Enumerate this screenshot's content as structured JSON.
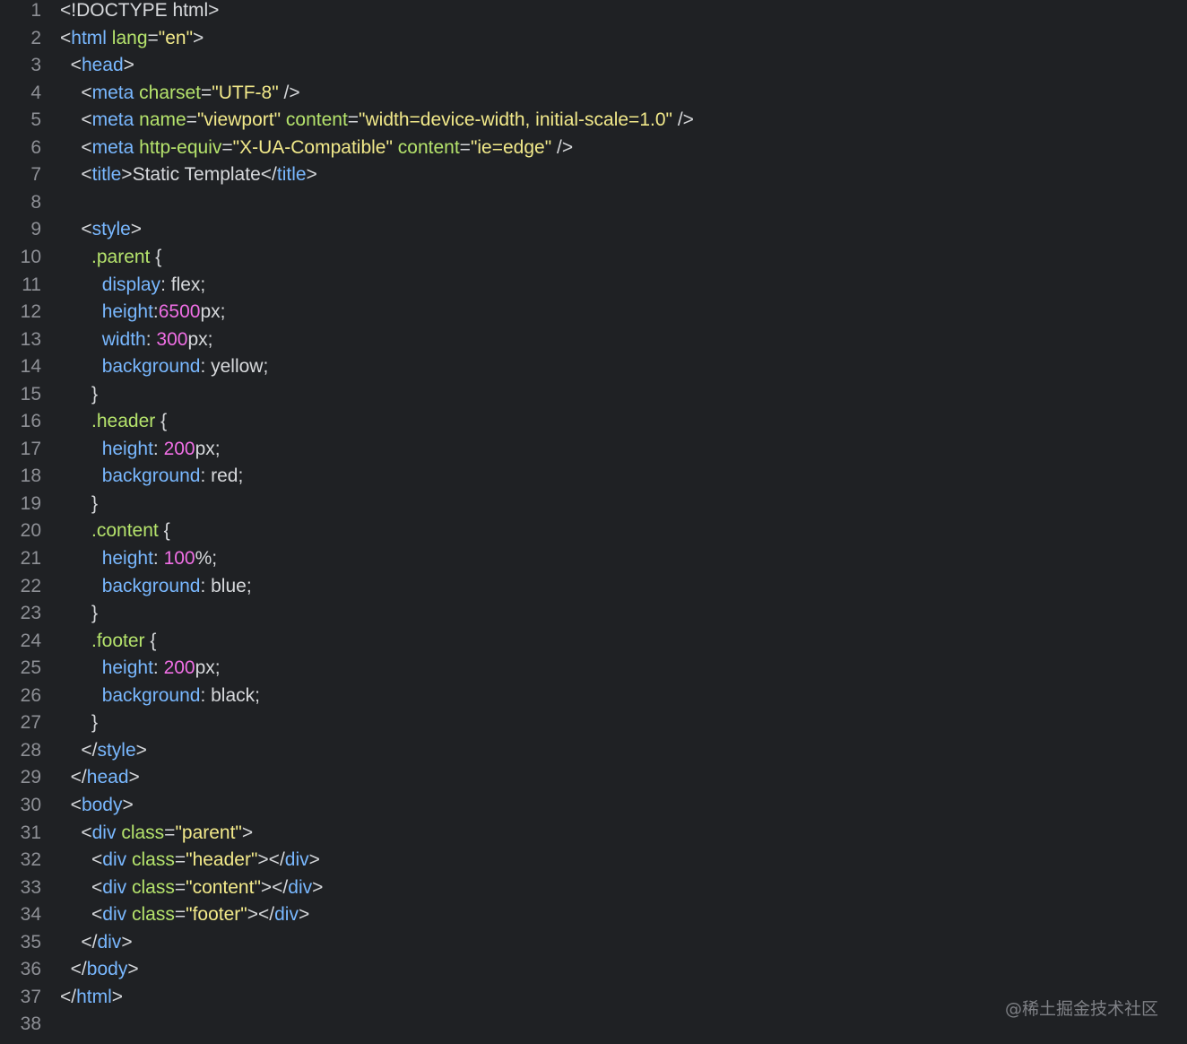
{
  "editor": {
    "lines": [
      {
        "n": "1",
        "tokens": [
          [
            "doctype",
            "<!DOCTYPE html>"
          ]
        ]
      },
      {
        "n": "2",
        "tokens": [
          [
            "punc",
            "<"
          ],
          [
            "tag",
            "html"
          ],
          [
            "text",
            " "
          ],
          [
            "attr",
            "lang"
          ],
          [
            "punc",
            "="
          ],
          [
            "str",
            "\"en\""
          ],
          [
            "punc",
            ">"
          ]
        ]
      },
      {
        "n": "3",
        "tokens": [
          [
            "text",
            "  "
          ],
          [
            "punc",
            "<"
          ],
          [
            "tag",
            "head"
          ],
          [
            "punc",
            ">"
          ]
        ]
      },
      {
        "n": "4",
        "tokens": [
          [
            "text",
            "    "
          ],
          [
            "punc",
            "<"
          ],
          [
            "tag",
            "meta"
          ],
          [
            "text",
            " "
          ],
          [
            "attr",
            "charset"
          ],
          [
            "punc",
            "="
          ],
          [
            "str",
            "\"UTF-8\""
          ],
          [
            "text",
            " "
          ],
          [
            "punc",
            "/>"
          ]
        ]
      },
      {
        "n": "5",
        "tokens": [
          [
            "text",
            "    "
          ],
          [
            "punc",
            "<"
          ],
          [
            "tag",
            "meta"
          ],
          [
            "text",
            " "
          ],
          [
            "attr",
            "name"
          ],
          [
            "punc",
            "="
          ],
          [
            "str",
            "\"viewport\""
          ],
          [
            "text",
            " "
          ],
          [
            "attr",
            "content"
          ],
          [
            "punc",
            "="
          ],
          [
            "str",
            "\"width=device-width, initial-scale=1.0\""
          ],
          [
            "text",
            " "
          ],
          [
            "punc",
            "/>"
          ]
        ]
      },
      {
        "n": "6",
        "tokens": [
          [
            "text",
            "    "
          ],
          [
            "punc",
            "<"
          ],
          [
            "tag",
            "meta"
          ],
          [
            "text",
            " "
          ],
          [
            "attr",
            "http-equiv"
          ],
          [
            "punc",
            "="
          ],
          [
            "str",
            "\"X-UA-Compatible\""
          ],
          [
            "text",
            " "
          ],
          [
            "attr",
            "content"
          ],
          [
            "punc",
            "="
          ],
          [
            "str",
            "\"ie=edge\""
          ],
          [
            "text",
            " "
          ],
          [
            "punc",
            "/>"
          ]
        ]
      },
      {
        "n": "7",
        "tokens": [
          [
            "text",
            "    "
          ],
          [
            "punc",
            "<"
          ],
          [
            "tag",
            "title"
          ],
          [
            "punc",
            ">"
          ],
          [
            "text",
            "Static Template"
          ],
          [
            "punc",
            "</"
          ],
          [
            "tag",
            "title"
          ],
          [
            "punc",
            ">"
          ]
        ]
      },
      {
        "n": "8",
        "tokens": []
      },
      {
        "n": "9",
        "tokens": [
          [
            "text",
            "    "
          ],
          [
            "punc",
            "<"
          ],
          [
            "tag",
            "style"
          ],
          [
            "punc",
            ">"
          ]
        ]
      },
      {
        "n": "10",
        "tokens": [
          [
            "text",
            "      "
          ],
          [
            "sel",
            ".parent"
          ],
          [
            "text",
            " "
          ],
          [
            "punc",
            "{"
          ]
        ]
      },
      {
        "n": "11",
        "tokens": [
          [
            "text",
            "        "
          ],
          [
            "prop",
            "display"
          ],
          [
            "punc",
            ": "
          ],
          [
            "val",
            "flex;"
          ]
        ]
      },
      {
        "n": "12",
        "tokens": [
          [
            "text",
            "        "
          ],
          [
            "prop",
            "height"
          ],
          [
            "punc",
            ":"
          ],
          [
            "num",
            "6500"
          ],
          [
            "val",
            "px;"
          ]
        ]
      },
      {
        "n": "13",
        "tokens": [
          [
            "text",
            "        "
          ],
          [
            "prop",
            "width"
          ],
          [
            "punc",
            ": "
          ],
          [
            "num",
            "300"
          ],
          [
            "val",
            "px;"
          ]
        ]
      },
      {
        "n": "14",
        "tokens": [
          [
            "text",
            "        "
          ],
          [
            "prop",
            "background"
          ],
          [
            "punc",
            ": "
          ],
          [
            "val",
            "yellow;"
          ]
        ]
      },
      {
        "n": "15",
        "tokens": [
          [
            "text",
            "      "
          ],
          [
            "punc",
            "}"
          ]
        ]
      },
      {
        "n": "16",
        "tokens": [
          [
            "text",
            "      "
          ],
          [
            "sel",
            ".header"
          ],
          [
            "text",
            " "
          ],
          [
            "punc",
            "{"
          ]
        ]
      },
      {
        "n": "17",
        "tokens": [
          [
            "text",
            "        "
          ],
          [
            "prop",
            "height"
          ],
          [
            "punc",
            ": "
          ],
          [
            "num",
            "200"
          ],
          [
            "val",
            "px;"
          ]
        ]
      },
      {
        "n": "18",
        "tokens": [
          [
            "text",
            "        "
          ],
          [
            "prop",
            "background"
          ],
          [
            "punc",
            ": "
          ],
          [
            "val",
            "red;"
          ]
        ]
      },
      {
        "n": "19",
        "tokens": [
          [
            "text",
            "      "
          ],
          [
            "punc",
            "}"
          ]
        ]
      },
      {
        "n": "20",
        "tokens": [
          [
            "text",
            "      "
          ],
          [
            "sel",
            ".content"
          ],
          [
            "text",
            " "
          ],
          [
            "punc",
            "{"
          ]
        ]
      },
      {
        "n": "21",
        "tokens": [
          [
            "text",
            "        "
          ],
          [
            "prop",
            "height"
          ],
          [
            "punc",
            ": "
          ],
          [
            "num",
            "100"
          ],
          [
            "val",
            "%;"
          ]
        ]
      },
      {
        "n": "22",
        "tokens": [
          [
            "text",
            "        "
          ],
          [
            "prop",
            "background"
          ],
          [
            "punc",
            ": "
          ],
          [
            "val",
            "blue;"
          ]
        ]
      },
      {
        "n": "23",
        "tokens": [
          [
            "text",
            "      "
          ],
          [
            "punc",
            "}"
          ]
        ]
      },
      {
        "n": "24",
        "tokens": [
          [
            "text",
            "      "
          ],
          [
            "sel",
            ".footer"
          ],
          [
            "text",
            " "
          ],
          [
            "punc",
            "{"
          ]
        ]
      },
      {
        "n": "25",
        "tokens": [
          [
            "text",
            "        "
          ],
          [
            "prop",
            "height"
          ],
          [
            "punc",
            ": "
          ],
          [
            "num",
            "200"
          ],
          [
            "val",
            "px;"
          ]
        ]
      },
      {
        "n": "26",
        "tokens": [
          [
            "text",
            "        "
          ],
          [
            "prop",
            "background"
          ],
          [
            "punc",
            ": "
          ],
          [
            "val",
            "black;"
          ]
        ]
      },
      {
        "n": "27",
        "tokens": [
          [
            "text",
            "      "
          ],
          [
            "punc",
            "}"
          ]
        ]
      },
      {
        "n": "28",
        "tokens": [
          [
            "text",
            "    "
          ],
          [
            "punc",
            "</"
          ],
          [
            "tag",
            "style"
          ],
          [
            "punc",
            ">"
          ]
        ]
      },
      {
        "n": "29",
        "tokens": [
          [
            "text",
            "  "
          ],
          [
            "punc",
            "</"
          ],
          [
            "tag",
            "head"
          ],
          [
            "punc",
            ">"
          ]
        ]
      },
      {
        "n": "30",
        "tokens": [
          [
            "text",
            "  "
          ],
          [
            "punc",
            "<"
          ],
          [
            "tag",
            "body"
          ],
          [
            "punc",
            ">"
          ]
        ]
      },
      {
        "n": "31",
        "tokens": [
          [
            "text",
            "    "
          ],
          [
            "punc",
            "<"
          ],
          [
            "tag",
            "div"
          ],
          [
            "text",
            " "
          ],
          [
            "attr",
            "class"
          ],
          [
            "punc",
            "="
          ],
          [
            "str",
            "\"parent\""
          ],
          [
            "punc",
            ">"
          ]
        ]
      },
      {
        "n": "32",
        "tokens": [
          [
            "text",
            "      "
          ],
          [
            "punc",
            "<"
          ],
          [
            "tag",
            "div"
          ],
          [
            "text",
            " "
          ],
          [
            "attr",
            "class"
          ],
          [
            "punc",
            "="
          ],
          [
            "str",
            "\"header\""
          ],
          [
            "punc",
            "></"
          ],
          [
            "tag",
            "div"
          ],
          [
            "punc",
            ">"
          ]
        ]
      },
      {
        "n": "33",
        "tokens": [
          [
            "text",
            "      "
          ],
          [
            "punc",
            "<"
          ],
          [
            "tag",
            "div"
          ],
          [
            "text",
            " "
          ],
          [
            "attr",
            "class"
          ],
          [
            "punc",
            "="
          ],
          [
            "str",
            "\"content\""
          ],
          [
            "punc",
            "></"
          ],
          [
            "tag",
            "div"
          ],
          [
            "punc",
            ">"
          ]
        ]
      },
      {
        "n": "34",
        "tokens": [
          [
            "text",
            "      "
          ],
          [
            "punc",
            "<"
          ],
          [
            "tag",
            "div"
          ],
          [
            "text",
            " "
          ],
          [
            "attr",
            "class"
          ],
          [
            "punc",
            "="
          ],
          [
            "str",
            "\"footer\""
          ],
          [
            "punc",
            "></"
          ],
          [
            "tag",
            "div"
          ],
          [
            "punc",
            ">"
          ]
        ]
      },
      {
        "n": "35",
        "tokens": [
          [
            "text",
            "    "
          ],
          [
            "punc",
            "</"
          ],
          [
            "tag",
            "div"
          ],
          [
            "punc",
            ">"
          ]
        ]
      },
      {
        "n": "36",
        "tokens": [
          [
            "text",
            "  "
          ],
          [
            "punc",
            "</"
          ],
          [
            "tag",
            "body"
          ],
          [
            "punc",
            ">"
          ]
        ]
      },
      {
        "n": "37",
        "tokens": [
          [
            "punc",
            "</"
          ],
          [
            "tag",
            "html"
          ],
          [
            "punc",
            ">"
          ]
        ]
      },
      {
        "n": "38",
        "tokens": []
      }
    ]
  },
  "watermark": "@稀土掘金技术社区",
  "colors": {
    "background": "#1f2124",
    "line_number": "#8e9096",
    "tag": "#79b8ff",
    "attribute": "#b5e36c",
    "string": "#f2e98a",
    "number": "#f06fe5",
    "text": "#d7d9dc"
  }
}
